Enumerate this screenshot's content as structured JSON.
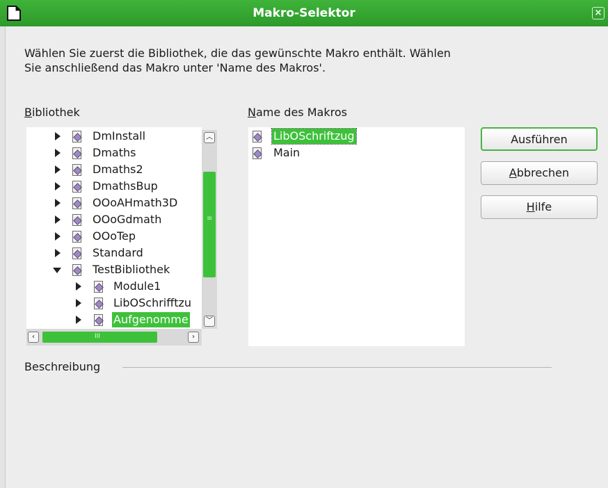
{
  "window": {
    "title": "Makro-Selektor",
    "close_glyph": "×"
  },
  "intro_text": "Wählen Sie zuerst die Bibliothek, die das gewünschte Makro enthält. Wählen Sie anschließend das Makro unter 'Name des Makros'.",
  "library": {
    "label_mnemonic": "B",
    "label_rest": "ibliothek",
    "items": [
      {
        "label": "DmInstall"
      },
      {
        "label": "Dmaths"
      },
      {
        "label": "Dmaths2"
      },
      {
        "label": "DmathsBup"
      },
      {
        "label": "OOoAHmath3D"
      },
      {
        "label": "OOoGdmath"
      },
      {
        "label": "OOoTep"
      },
      {
        "label": "Standard"
      },
      {
        "label": "TestBibliothek",
        "expanded": true
      },
      {
        "label": "Module1",
        "child": true
      },
      {
        "label": "LibOSchrifftzu",
        "child": true
      },
      {
        "label": "Aufgenomme",
        "child": true,
        "selected": true
      }
    ],
    "hscroll_marker": "III",
    "vscroll_marker": "≡"
  },
  "macros": {
    "label_mnemonic": "N",
    "label_rest": "ame des Makros",
    "items": [
      {
        "label": "LibOSchriftzug",
        "selected": true
      },
      {
        "label": "Main"
      }
    ]
  },
  "buttons": {
    "run": "Ausführen",
    "cancel_mnemonic": "A",
    "cancel_rest": "bbrechen",
    "help_mnemonic": "H",
    "help_rest": "ilfe"
  },
  "description": {
    "label": "Beschreibung"
  },
  "colors": {
    "accent": "#3ec13a",
    "titlebar": "#2c9a2a"
  },
  "icons": [
    "window-icon",
    "close-icon",
    "expand-arrow-icon",
    "collapse-arrow-icon",
    "module-icon",
    "macro-icon",
    "scroll-up-icon",
    "scroll-down-icon",
    "scroll-left-icon",
    "scroll-right-icon"
  ]
}
